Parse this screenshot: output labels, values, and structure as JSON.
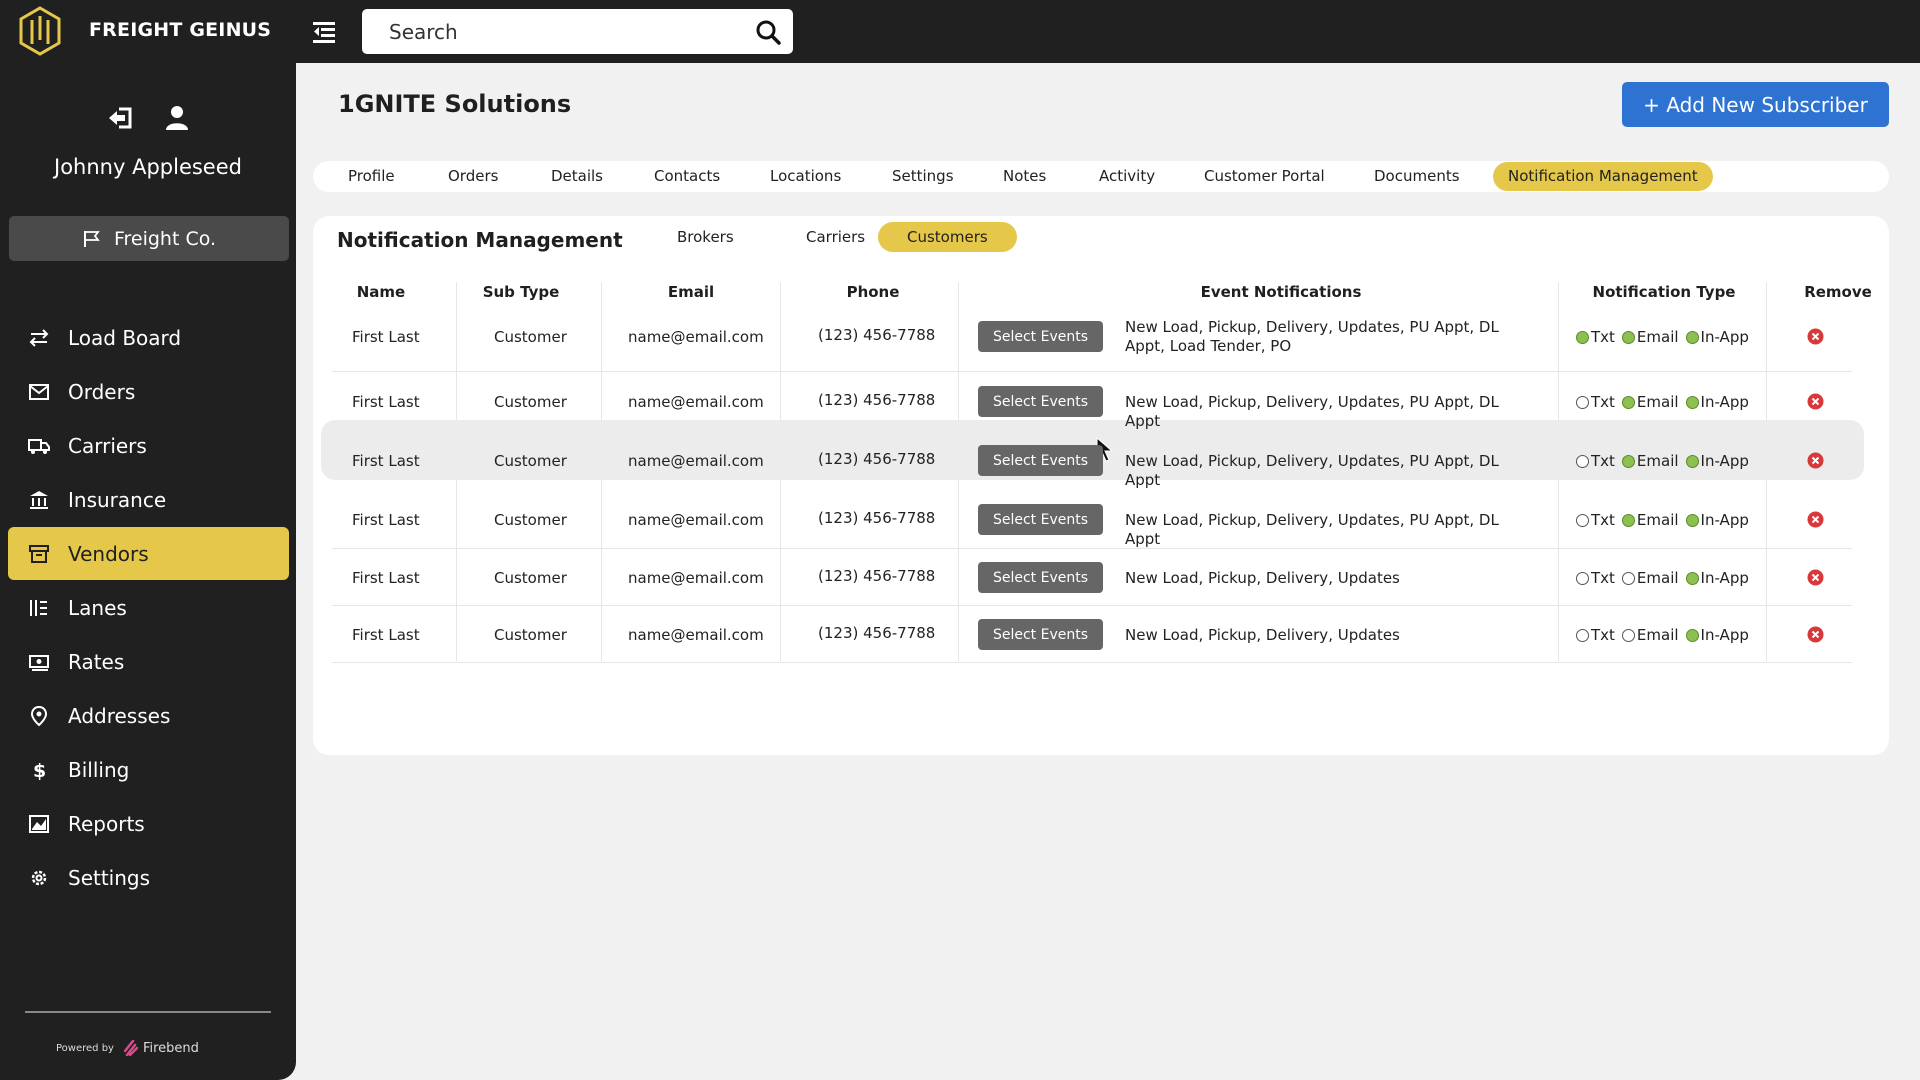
{
  "app": {
    "brand": "FREIGHT GEINUS"
  },
  "search": {
    "placeholder": "Search"
  },
  "user": {
    "name": "Johnny Appleseed",
    "company": "Freight Co."
  },
  "nav": [
    {
      "label": "Load Board",
      "icon": "transfer-icon"
    },
    {
      "label": "Orders",
      "icon": "mail-icon"
    },
    {
      "label": "Carriers",
      "icon": "truck-icon"
    },
    {
      "label": "Insurance",
      "icon": "bank-icon"
    },
    {
      "label": "Vendors",
      "icon": "archive-icon",
      "active": true
    },
    {
      "label": "Lanes",
      "icon": "lanes-icon"
    },
    {
      "label": "Rates",
      "icon": "money-icon"
    },
    {
      "label": "Addresses",
      "icon": "pin-icon"
    },
    {
      "label": "Billing",
      "icon": "dollar-icon"
    },
    {
      "label": "Reports",
      "icon": "chart-icon"
    },
    {
      "label": "Settings",
      "icon": "gear-icon"
    }
  ],
  "footer": {
    "powered_by": "Powered by",
    "partner": "Firebend"
  },
  "page": {
    "title": "1GNITE Solutions",
    "add_button": "+ Add New Subscriber"
  },
  "tabs": [
    "Profile",
    "Orders",
    "Details",
    "Contacts",
    "Locations",
    "Settings",
    "Notes",
    "Activity",
    "Customer Portal",
    "Documents",
    "Notification Management"
  ],
  "active_tab": "Notification Management",
  "panel": {
    "title": "Notification Management",
    "subtabs": [
      "Brokers",
      "Carriers",
      "Customers"
    ],
    "active_subtab": "Customers"
  },
  "table": {
    "headers": [
      "Name",
      "Sub Type",
      "Email",
      "Phone",
      "Event Notifications",
      "Notification Type",
      "Remove"
    ],
    "select_label": "Select Events",
    "type_labels": [
      "Txt",
      "Email",
      "In-App"
    ],
    "rows": [
      {
        "name": "First Last",
        "subtype": "Customer",
        "email": "name@email.com",
        "phone": "(123) 456-7788",
        "events": "New Load, Pickup, Delivery, Updates, PU Appt, DL Appt, Load Tender, PO",
        "txt": true,
        "email_on": true,
        "inapp": true
      },
      {
        "name": "First Last",
        "subtype": "Customer",
        "email": "name@email.com",
        "phone": "(123) 456-7788",
        "events": "New Load, Pickup, Delivery, Updates, PU Appt, DL Appt",
        "txt": false,
        "email_on": true,
        "inapp": true
      },
      {
        "name": "First Last",
        "subtype": "Customer",
        "email": "name@email.com",
        "phone": "(123) 456-7788",
        "events": "New Load, Pickup, Delivery, Updates, PU Appt, DL Appt",
        "txt": false,
        "email_on": true,
        "inapp": true
      },
      {
        "name": "First Last",
        "subtype": "Customer",
        "email": "name@email.com",
        "phone": "(123) 456-7788",
        "events": "New Load, Pickup, Delivery, Updates, PU Appt, DL Appt",
        "txt": false,
        "email_on": true,
        "inapp": true
      },
      {
        "name": "First Last",
        "subtype": "Customer",
        "email": "name@email.com",
        "phone": "(123) 456-7788",
        "events": "New Load, Pickup, Delivery, Updates",
        "txt": false,
        "email_on": false,
        "inapp": true
      },
      {
        "name": "First Last",
        "subtype": "Customer",
        "email": "name@email.com",
        "phone": "(123) 456-7788",
        "events": "New Load, Pickup, Delivery, Updates",
        "txt": false,
        "email_on": false,
        "inapp": true
      }
    ]
  },
  "colors": {
    "accent": "#e5c84a",
    "primary": "#2e72d2",
    "sidebar": "#202020",
    "on": "#8cc152",
    "remove": "#d9383a"
  }
}
